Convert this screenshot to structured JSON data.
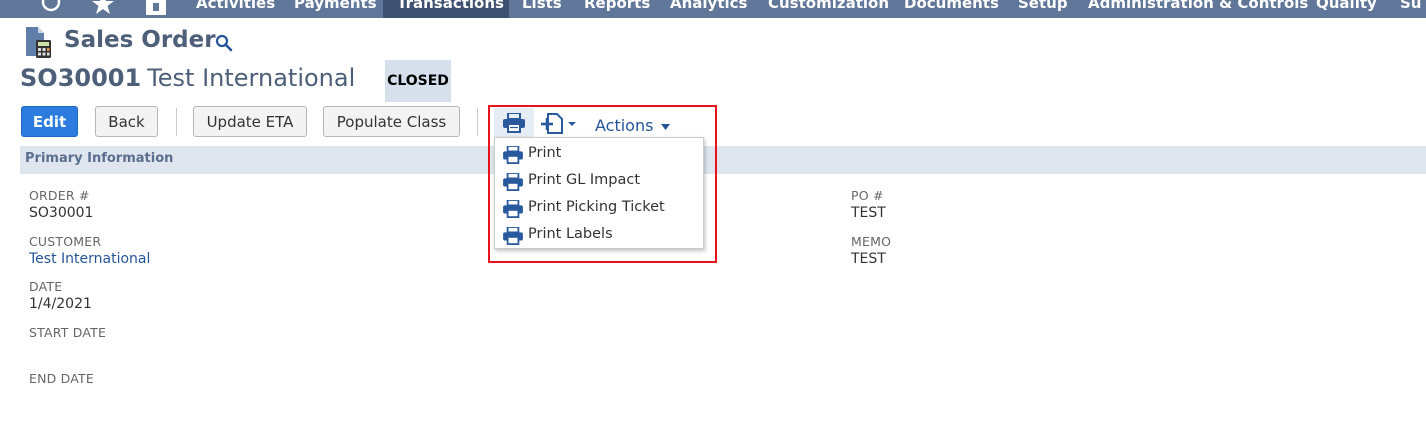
{
  "nav": {
    "items": [
      "Activities",
      "Payments",
      "Transactions",
      "Lists",
      "Reports",
      "Analytics",
      "Customization",
      "Documents",
      "Setup",
      "Administration & Controls",
      "Quality",
      "Su"
    ],
    "active_index": 2
  },
  "header": {
    "page_title": "Sales Order",
    "record_number": "SO30001",
    "record_name": "Test International",
    "status": "CLOSED"
  },
  "toolbar": {
    "edit": "Edit",
    "back": "Back",
    "update_eta": "Update ETA",
    "populate_class": "Populate Class",
    "actions": "Actions"
  },
  "print_menu": {
    "items": [
      "Print",
      "Print GL Impact",
      "Print Picking Ticket",
      "Print Labels"
    ]
  },
  "section": {
    "title": "Primary Information"
  },
  "fields": {
    "order_label": "ORDER #",
    "order_value": "SO30001",
    "customer_label": "CUSTOMER",
    "customer_value": "Test International",
    "date_label": "DATE",
    "date_value": "1/4/2021",
    "start_date_label": "START DATE",
    "end_date_label": "END DATE",
    "po_label": "PO #",
    "po_value": "TEST",
    "memo_label": "MEMO",
    "memo_value": "TEST"
  },
  "colors": {
    "nav_bg": "#607799",
    "nav_active": "#3f5170",
    "primary_button": "#2c7ce0",
    "highlight_border": "#e5141c",
    "link": "#255599"
  }
}
